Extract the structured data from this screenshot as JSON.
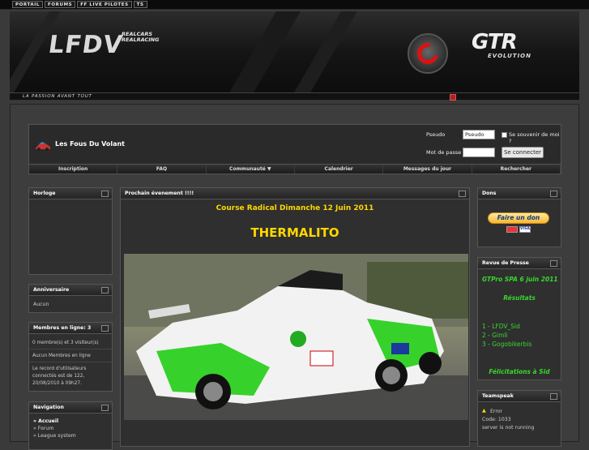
{
  "topnav": [
    "PORTAIL",
    "FORUMS",
    "FF LIVE PILOTES",
    "TS"
  ],
  "banner": {
    "logo_text": "LFDV",
    "partner_line1": "REALCARS",
    "partner_line2": "REALRACING",
    "gtr_title": "GTR",
    "gtr_subtitle": "EVOLUTION",
    "slogan": "LA PASSION AVANT TOUT"
  },
  "header": {
    "site_title": "Les Fous Du Volant",
    "pseudo_label": "Pseudo",
    "pseudo_value": "Pseudo",
    "remember_label": "Se souvenir de moi ?",
    "password_label": "Mot de passe",
    "login_button": "Se connecter"
  },
  "menu": [
    "Inscription",
    "FAQ",
    "Communauté ▼",
    "Calendrier",
    "Messages du jour",
    "Rechercher"
  ],
  "left": {
    "horloge": {
      "title": "Horloge"
    },
    "anniversaire": {
      "title": "Anniversaire",
      "text": "Aucun"
    },
    "membres": {
      "title": "Membres en ligne: 3",
      "line1": "0 membre(s) et 3 visiteur(s)",
      "line2": "Aucun Membres en ligne",
      "record1": "Le record d'utilisateurs",
      "record2": "connectés est de 122,",
      "record3": "20/08/2010 à 09h27."
    },
    "navigation": {
      "title": "Navigation",
      "items": [
        "» Accueil",
        "» Forum",
        "» League system"
      ]
    }
  },
  "center": {
    "title": "Prochain évenement !!!!",
    "event": "Course Radical Dimanche 12 Juin 2011",
    "track": "THERMALITO"
  },
  "right": {
    "dons": {
      "title": "Dons",
      "button": "Faire un don",
      "cards": [
        "MC",
        "VISA"
      ]
    },
    "revue": {
      "title": "Revue de Presse",
      "headline": "GTPro SPA 6 juin 2011",
      "resultats": "Résultats",
      "results": [
        "1 - LFDV_Sid",
        "2 - Gimli",
        "3 - Gogobikerbis"
      ],
      "congrats": "Félicitations à Sid"
    },
    "teamspeak": {
      "title": "Teamspeak",
      "error": "Error",
      "code": "Code: 1033",
      "status": "server is not running"
    }
  }
}
